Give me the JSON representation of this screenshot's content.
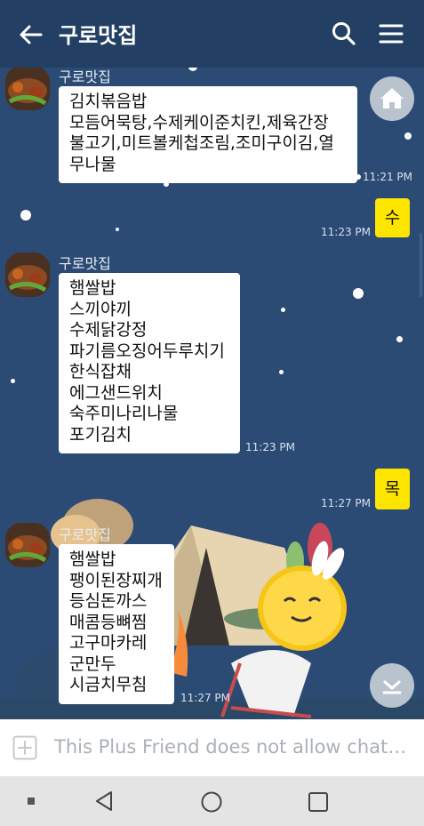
{
  "header": {
    "title": "구로맛집"
  },
  "messages": [
    {
      "sender": "구로맛집",
      "lines": [
        "김치볶음밥",
        "모듬어묵탕,수제케이준치킨,제육간장",
        "불고기,미트볼케첩조림,조미구이김,열",
        "무나물"
      ],
      "time": "11:21 PM"
    },
    {
      "mine_text": "수",
      "time": "11:23 PM"
    },
    {
      "sender": "구로맛집",
      "lines": [
        "햄쌀밥",
        "스끼야끼",
        "수제닭강정",
        "파기름오징어두루치기",
        "한식잡채",
        "에그샌드위치",
        "숙주미나리나물",
        "포기김치"
      ],
      "time": "11:23 PM"
    },
    {
      "mine_text": "목",
      "time": "11:27 PM"
    },
    {
      "sender": "구로맛집",
      "lines": [
        "햄쌀밥",
        "팽이된장찌개",
        "등심돈까스",
        "매콤등뼈찜",
        "고구마카레",
        "군만두",
        "시금치무침"
      ],
      "time": "11:27 PM"
    }
  ],
  "input": {
    "placeholder": "This Plus Friend does not allow chatting."
  },
  "icons": {
    "back": "arrow-left-icon",
    "search": "search-icon",
    "menu": "hamburger-menu-icon",
    "home": "home-icon",
    "scroll_down": "chevron-down-icon",
    "attach": "plus-box-icon",
    "nav_back": "triangle-back-icon",
    "nav_home": "circle-home-icon",
    "nav_recent": "square-recent-icon"
  },
  "colors": {
    "header_bg": "#233f63",
    "chat_bg": "#2b4b75",
    "my_bubble": "#fee500",
    "bubble": "#ffffff"
  }
}
